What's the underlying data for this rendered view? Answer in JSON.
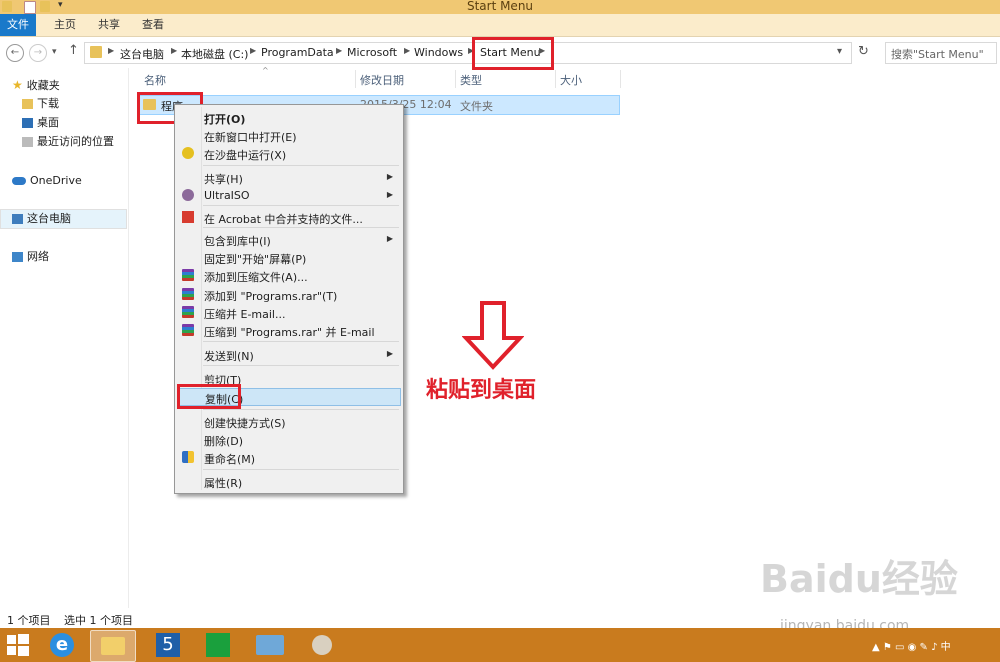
{
  "window": {
    "title": "Start Menu"
  },
  "ribbon": {
    "tabs": [
      "文件",
      "主页",
      "共享",
      "查看"
    ]
  },
  "address": {
    "crumbs": [
      "这台电脑",
      "本地磁盘 (C:)",
      "ProgramData",
      "Microsoft",
      "Windows",
      "Start Menu"
    ],
    "search_placeholder": "搜索\"Start Menu\""
  },
  "nav": {
    "favorites": "收藏夹",
    "downloads": "下载",
    "desktop": "桌面",
    "recent": "最近访问的位置",
    "onedrive": "OneDrive",
    "thispc": "这台电脑",
    "network": "网络"
  },
  "columns": {
    "name": "名称",
    "date": "修改日期",
    "type": "类型",
    "size": "大小"
  },
  "file": {
    "name": "程序",
    "date": "2015/3/25 12:04",
    "type": "文件夹"
  },
  "context_menu": {
    "open": "打开(O)",
    "open_new_window": "在新窗口中打开(E)",
    "sandbox": "在沙盘中运行(X)",
    "share": "共享(H)",
    "ultraiso": "UltraISO",
    "acrobat": "在 Acrobat 中合并支持的文件...",
    "include_library": "包含到库中(I)",
    "pin_start": "固定到\"开始\"屏幕(P)",
    "add_archive": "添加到压缩文件(A)...",
    "add_rar": "添加到 \"Programs.rar\"(T)",
    "compress_email": "压缩并 E-mail...",
    "compress_rar_email": "压缩到 \"Programs.rar\" 并 E-mail",
    "send_to": "发送到(N)",
    "cut": "剪切(T)",
    "copy": "复制(C)",
    "create_shortcut": "创建快捷方式(S)",
    "delete": "删除(D)",
    "rename": "重命名(M)",
    "properties": "属性(R)"
  },
  "annotation": {
    "text": "粘贴到桌面"
  },
  "status": {
    "count": "1 个项目",
    "selected": "选中 1 个项目"
  },
  "watermark": {
    "logo": "Baidu经验",
    "url": "jingyan.baidu.com"
  },
  "colors": {
    "accent": "#1979ca",
    "annotation_red": "#e0212b",
    "taskbar": "#c97b1e",
    "selection": "#cce8ff"
  }
}
